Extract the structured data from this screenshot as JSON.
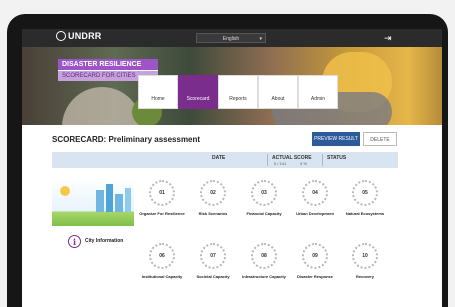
{
  "header": {
    "logo_text": "UNDRR",
    "language": "English",
    "logout_icon": "logout-icon"
  },
  "brand": {
    "line1": "DISASTER RESILIENCE",
    "line2": "SCORECARD FOR CITIES"
  },
  "nav": [
    {
      "label": "Home",
      "active": false
    },
    {
      "label": "Scorecard",
      "active": true
    },
    {
      "label": "Reports",
      "active": false
    },
    {
      "label": "About",
      "active": false
    },
    {
      "label": "Admin",
      "active": false
    }
  ],
  "page": {
    "title": "SCORECARD: Preliminary assessment",
    "preview_label": "PREVIEW RESULT",
    "delete_label": "DELETE"
  },
  "status_header": {
    "date_label": "DATE",
    "actual_score_label": "ACTUAL SCORE",
    "score_sub1": "0 / 141",
    "score_sub2": "0 %",
    "status_label": "STATUS"
  },
  "city_info": {
    "label": "City Information",
    "icon": "info-icon"
  },
  "essentials": [
    {
      "num": "01",
      "label": "Organize For Resilience"
    },
    {
      "num": "02",
      "label": "Risk Scenarios"
    },
    {
      "num": "03",
      "label": "Financial Capacity"
    },
    {
      "num": "04",
      "label": "Urban Development"
    },
    {
      "num": "05",
      "label": "Natural Ecosystems"
    },
    {
      "num": "06",
      "label": "Institutional Capacity"
    },
    {
      "num": "07",
      "label": "Societal Capacity"
    },
    {
      "num": "08",
      "label": "Infrastructure Capacity"
    },
    {
      "num": "09",
      "label": "Disaster Response"
    },
    {
      "num": "10",
      "label": "Recovery"
    }
  ],
  "colors": {
    "accent": "#7b2d8e",
    "primary_button": "#2c5a9a",
    "header_band": "#d8e4ef"
  }
}
